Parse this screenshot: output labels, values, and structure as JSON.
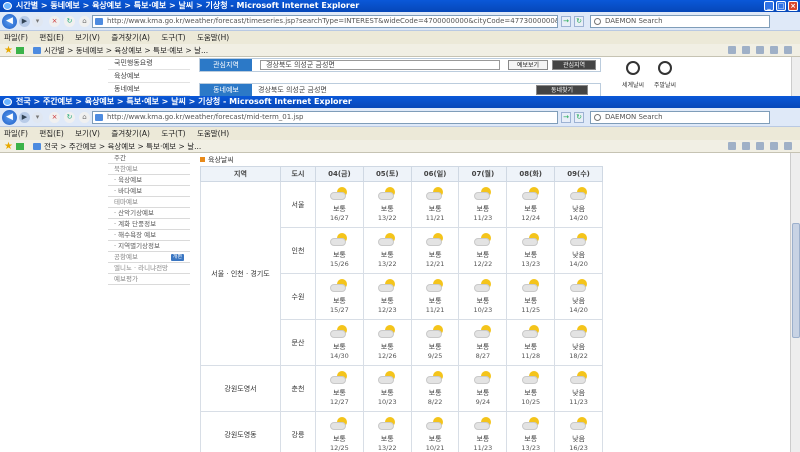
{
  "window1": {
    "title": "시간별 > 동네예보 > 육상예보 > 특보·예보 > 날씨 > 기상청 - Microsoft Internet Explorer",
    "url": "http://www.kma.go.kr/weather/forecast/timeseries.jsp?searchType=INTEREST&wideCode=4700000000&cityCode=4773000000&dongCode=",
    "search_text": "DAEMON Search",
    "tab_label": "시간별 > 동네예보 > 육상예보 > 특보·예보 > 날...",
    "sidebar_items": [
      "국민행동요령",
      "육상예보",
      "동네예보"
    ],
    "box1_label": "관심지역",
    "box1_text": "경상북도 의성군 금성면",
    "box1_btn1": "예보보기",
    "box1_btn2": "관심지역",
    "box2_label": "동네예보",
    "box2_text": "경상북도 의성군 금성면",
    "box2_btn": "동네찾기",
    "right_items": [
      "세계날씨",
      "주말날씨"
    ]
  },
  "window2": {
    "title": "전국 > 주간예보 > 육상예보 > 특보·예보 > 날씨 > 기상청 - Microsoft Internet Explorer",
    "url": "http://www.kma.go.kr/weather/forecast/mid-term_01.jsp",
    "search_text": "DAEMON Search",
    "tab_label": "전국 > 주간예보 > 육상예보 > 특보·예보 > 날...",
    "favorites_icon": "star-icon"
  },
  "menu": [
    "파일(F)",
    "편집(E)",
    "보기(V)",
    "즐겨찾기(A)",
    "도구(T)",
    "도움말(H)"
  ],
  "sidebar": [
    {
      "label": "주간",
      "grey": false
    },
    {
      "label": "북한예보",
      "grey": true
    },
    {
      "label": "· 육상예보",
      "grey": false
    },
    {
      "label": "· 바다예보",
      "grey": false
    },
    {
      "label": "테마예보",
      "grey": true
    },
    {
      "label": "· 산악기상예보",
      "grey": false
    },
    {
      "label": "· 계화 단풍정보",
      "grey": false
    },
    {
      "label": "· 해수욕장 예보",
      "grey": false
    },
    {
      "label": "· 지역별기상정보",
      "grey": false
    },
    {
      "label": "공항예보",
      "grey": true,
      "badge": "개편"
    },
    {
      "label": "엘니뇨 · 라니냐전망",
      "grey": true
    },
    {
      "label": "예보평가",
      "grey": true
    }
  ],
  "panel_title": "육상날씨",
  "table": {
    "headers": [
      "지역",
      "도시",
      "04(금)",
      "05(토)",
      "06(일)",
      "07(월)",
      "08(화)",
      "09(수)"
    ],
    "groups": [
      {
        "region": "서울 · 인천 · 경기도",
        "cities": [
          {
            "name": "서울",
            "days": [
              [
                "보통",
                "16/27"
              ],
              [
                "보통",
                "13/22"
              ],
              [
                "보통",
                "11/21"
              ],
              [
                "보통",
                "11/23"
              ],
              [
                "보통",
                "12/24"
              ],
              [
                "낮음",
                "14/20"
              ]
            ]
          },
          {
            "name": "인천",
            "days": [
              [
                "보통",
                "15/26"
              ],
              [
                "보통",
                "13/22"
              ],
              [
                "보통",
                "12/21"
              ],
              [
                "보통",
                "12/22"
              ],
              [
                "보통",
                "13/23"
              ],
              [
                "낮음",
                "14/20"
              ]
            ]
          },
          {
            "name": "수원",
            "days": [
              [
                "보통",
                "15/27"
              ],
              [
                "보통",
                "12/23"
              ],
              [
                "보통",
                "11/21"
              ],
              [
                "보통",
                "10/23"
              ],
              [
                "보통",
                "11/25"
              ],
              [
                "낮음",
                "14/20"
              ]
            ]
          },
          {
            "name": "문산",
            "days": [
              [
                "보통",
                "14/30"
              ],
              [
                "보통",
                "12/26"
              ],
              [
                "보통",
                "9/25"
              ],
              [
                "보통",
                "8/27"
              ],
              [
                "보통",
                "11/28"
              ],
              [
                "낮음",
                "18/22"
              ]
            ]
          }
        ]
      },
      {
        "region": "강원도영서",
        "cities": [
          {
            "name": "춘천",
            "days": [
              [
                "보통",
                "12/27"
              ],
              [
                "보통",
                "10/23"
              ],
              [
                "보통",
                "8/22"
              ],
              [
                "보통",
                "9/24"
              ],
              [
                "보통",
                "10/25"
              ],
              [
                "낮음",
                "11/23"
              ]
            ]
          }
        ]
      },
      {
        "region": "강원도영동",
        "cities": [
          {
            "name": "강릉",
            "days": [
              [
                "보통",
                "12/25"
              ],
              [
                "보통",
                "13/22"
              ],
              [
                "보통",
                "10/21"
              ],
              [
                "보통",
                "11/23"
              ],
              [
                "보통",
                "13/23"
              ],
              [
                "낮음",
                "16/23"
              ]
            ]
          }
        ]
      }
    ]
  },
  "colors": {
    "titlebar": "#0a58d8",
    "label_blue": "#2c79c7",
    "header_bg": "#eef3f9",
    "sun": "#f4c41b"
  }
}
